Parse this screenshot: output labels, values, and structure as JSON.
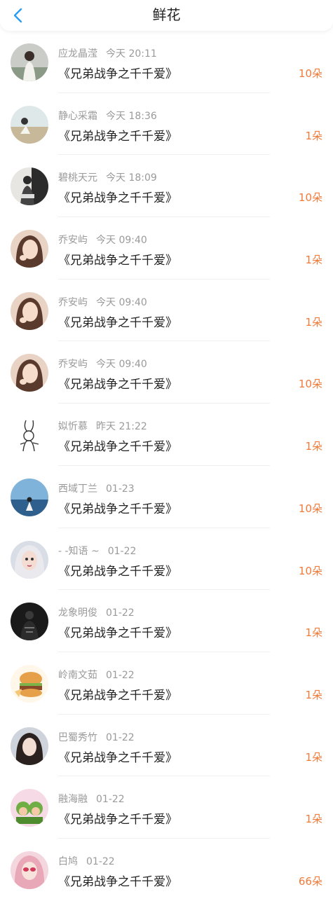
{
  "header": {
    "title": "鲜花",
    "back_icon": "chevron-left-icon",
    "back_color": "#2a9df4"
  },
  "accent": {
    "count_color": "#f07a3a"
  },
  "items": [
    {
      "user": "应龙晶滢",
      "time": "今天 20:11",
      "title": "《兄弟战争之千千爱》",
      "count": "10朵",
      "avatar": "avatar-photo"
    },
    {
      "user": "静心采霜",
      "time": "今天 18:36",
      "title": "《兄弟战争之千千爱》",
      "count": "1朵",
      "avatar": "avatar-photo"
    },
    {
      "user": "碧桃天元",
      "time": "今天 18:09",
      "title": "《兄弟战争之千千爱》",
      "count": "10朵",
      "avatar": "avatar-photo"
    },
    {
      "user": "乔安屿",
      "time": "今天 09:40",
      "title": "《兄弟战争之千千爱》",
      "count": "1朵",
      "avatar": "avatar-photo"
    },
    {
      "user": "乔安屿",
      "time": "今天 09:40",
      "title": "《兄弟战争之千千爱》",
      "count": "1朵",
      "avatar": "avatar-photo"
    },
    {
      "user": "乔安屿",
      "time": "今天 09:40",
      "title": "《兄弟战争之千千爱》",
      "count": "10朵",
      "avatar": "avatar-photo"
    },
    {
      "user": "姒忻慕",
      "time": "昨天 21:22",
      "title": "《兄弟战争之千千爱》",
      "count": "1朵",
      "avatar": "avatar-rabbit-sketch"
    },
    {
      "user": "西域丁兰",
      "time": "01-23",
      "title": "《兄弟战争之千千爱》",
      "count": "10朵",
      "avatar": "avatar-photo"
    },
    {
      "user": "- -知语 ~",
      "time": "01-22",
      "title": "《兄弟战争之千千爱》",
      "count": "10朵",
      "avatar": "avatar-photo"
    },
    {
      "user": "龙象明俊",
      "time": "01-22",
      "title": "《兄弟战争之千千爱》",
      "count": "1朵",
      "avatar": "avatar-photo"
    },
    {
      "user": "岭南文茹",
      "time": "01-22",
      "title": "《兄弟战争之千千爱》",
      "count": "1朵",
      "avatar": "avatar-burger"
    },
    {
      "user": "巴蜀秀竹",
      "time": "01-22",
      "title": "《兄弟战争之千千爱》",
      "count": "1朵",
      "avatar": "avatar-photo"
    },
    {
      "user": "融海融",
      "time": "01-22",
      "title": "《兄弟战争之千千爱》",
      "count": "1朵",
      "avatar": "avatar-cartoon"
    },
    {
      "user": "白鸠",
      "time": "01-22",
      "title": "《兄弟战争之千千爱》",
      "count": "66朵",
      "avatar": "avatar-photo"
    }
  ]
}
